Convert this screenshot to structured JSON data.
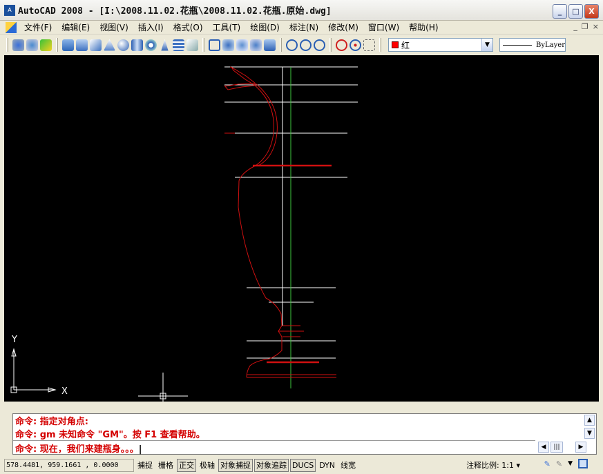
{
  "window": {
    "title": "AutoCAD 2008 - [I:\\2008.11.02.花瓶\\2008.11.02.花瓶.原始.dwg]",
    "app_icon": "autocad-icon"
  },
  "menu": [
    "文件(F)",
    "编辑(E)",
    "视图(V)",
    "插入(I)",
    "格式(O)",
    "工具(T)",
    "绘图(D)",
    "标注(N)",
    "修改(M)",
    "窗口(W)",
    "帮助(H)"
  ],
  "toolbar": {
    "layer": "红",
    "layer_color": "#ff0000",
    "linetype": "ByLayer"
  },
  "drawing": {
    "background": "#000000",
    "axis_x": "X",
    "axis_y": "Y",
    "profile_color": "#d01010",
    "guide_color": "#ffffff",
    "centerline_color": "#3ec83e"
  },
  "command": {
    "lines": [
      "命令: 指定对角点:",
      "命令: gm 未知命令 \"GM\"。按 F1 查看帮助。",
      "命令: 现在，我们来建瓶身。。。"
    ]
  },
  "status": {
    "coords": "578.4481,  959.1661 , 0.0000",
    "toggles": [
      {
        "label": "捕捉",
        "on": false
      },
      {
        "label": "栅格",
        "on": false
      },
      {
        "label": "正交",
        "on": true
      },
      {
        "label": "极轴",
        "on": false
      },
      {
        "label": "对象捕捉",
        "on": true
      },
      {
        "label": "对象追踪",
        "on": true
      },
      {
        "label": "DUCS",
        "on": true
      },
      {
        "label": "DYN",
        "on": false
      },
      {
        "label": "线宽",
        "on": false
      }
    ],
    "annotation_scale": "注释比例: 1:1 ▾"
  }
}
